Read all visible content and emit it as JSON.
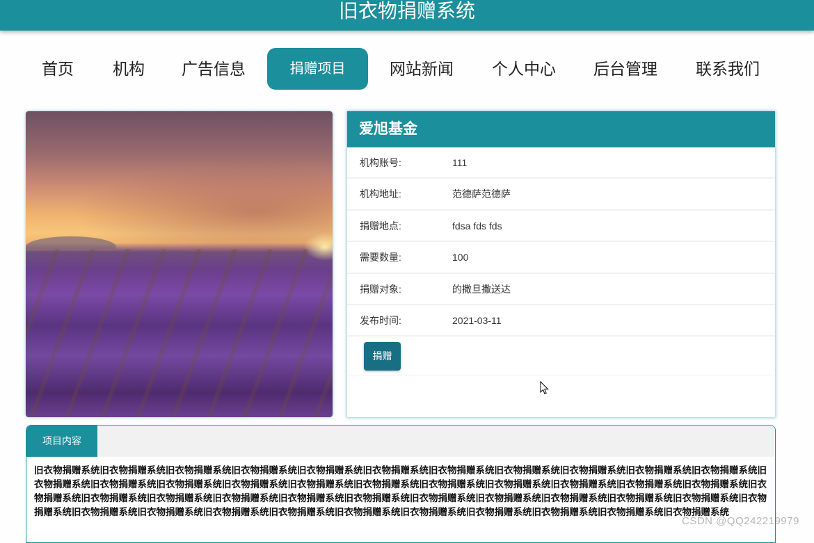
{
  "header": {
    "title": "旧衣物捐赠系统"
  },
  "nav": {
    "items": [
      {
        "label": "首页",
        "active": false
      },
      {
        "label": "机构",
        "active": false
      },
      {
        "label": "广告信息",
        "active": false
      },
      {
        "label": "捐赠项目",
        "active": true
      },
      {
        "label": "网站新闻",
        "active": false
      },
      {
        "label": "个人中心",
        "active": false
      },
      {
        "label": "后台管理",
        "active": false
      },
      {
        "label": "联系我们",
        "active": false
      }
    ]
  },
  "project": {
    "image_alt": "lavender-field-sunset",
    "org_name": "爱旭基金",
    "fields": [
      {
        "label": "机构账号:",
        "value": "111"
      },
      {
        "label": "机构地址:",
        "value": "范德萨范德萨"
      },
      {
        "label": "捐赠地点:",
        "value": "fdsa fds fds"
      },
      {
        "label": "需要数量:",
        "value": "100"
      },
      {
        "label": "捐赠对象:",
        "value": "的撒旦撒送达"
      },
      {
        "label": "发布时间:",
        "value": "2021-03-11"
      }
    ],
    "donate_button": "捐赠"
  },
  "content": {
    "tab_label": "项目内容",
    "text": "旧衣物捐赠系统旧衣物捐赠系统旧衣物捐赠系统旧衣物捐赠系统旧衣物捐赠系统旧衣物捐赠系统旧衣物捐赠系统旧衣物捐赠系统旧衣物捐赠系统旧衣物捐赠系统旧衣物捐赠系统旧衣物捐赠系统旧衣物捐赠系统旧衣物捐赠系统旧衣物捐赠系统旧衣物捐赠系统旧衣物捐赠系统旧衣物捐赠系统旧衣物捐赠系统旧衣物捐赠系统旧衣物捐赠系统旧衣物捐赠系统旧衣物捐赠系统旧衣物捐赠系统旧衣物捐赠系统旧衣物捐赠系统旧衣物捐赠系统旧衣物捐赠系统旧衣物捐赠系统旧衣物捐赠系统旧衣物捐赠系统旧衣物捐赠系统旧衣物捐赠系统旧衣物捐赠系统旧衣物捐赠系统旧衣物捐赠系统旧衣物捐赠系统旧衣物捐赠系统旧衣物捐赠系统旧衣物捐赠系统旧衣物捐赠系统旧衣物捐赠系统旧衣物捐赠系统旧衣物捐赠系统"
  },
  "watermark": "CSDN @QQ242219979",
  "colors": {
    "primary": "#1b8f9b",
    "button": "#186f84",
    "tabbar_bg": "#f1f1f1"
  }
}
